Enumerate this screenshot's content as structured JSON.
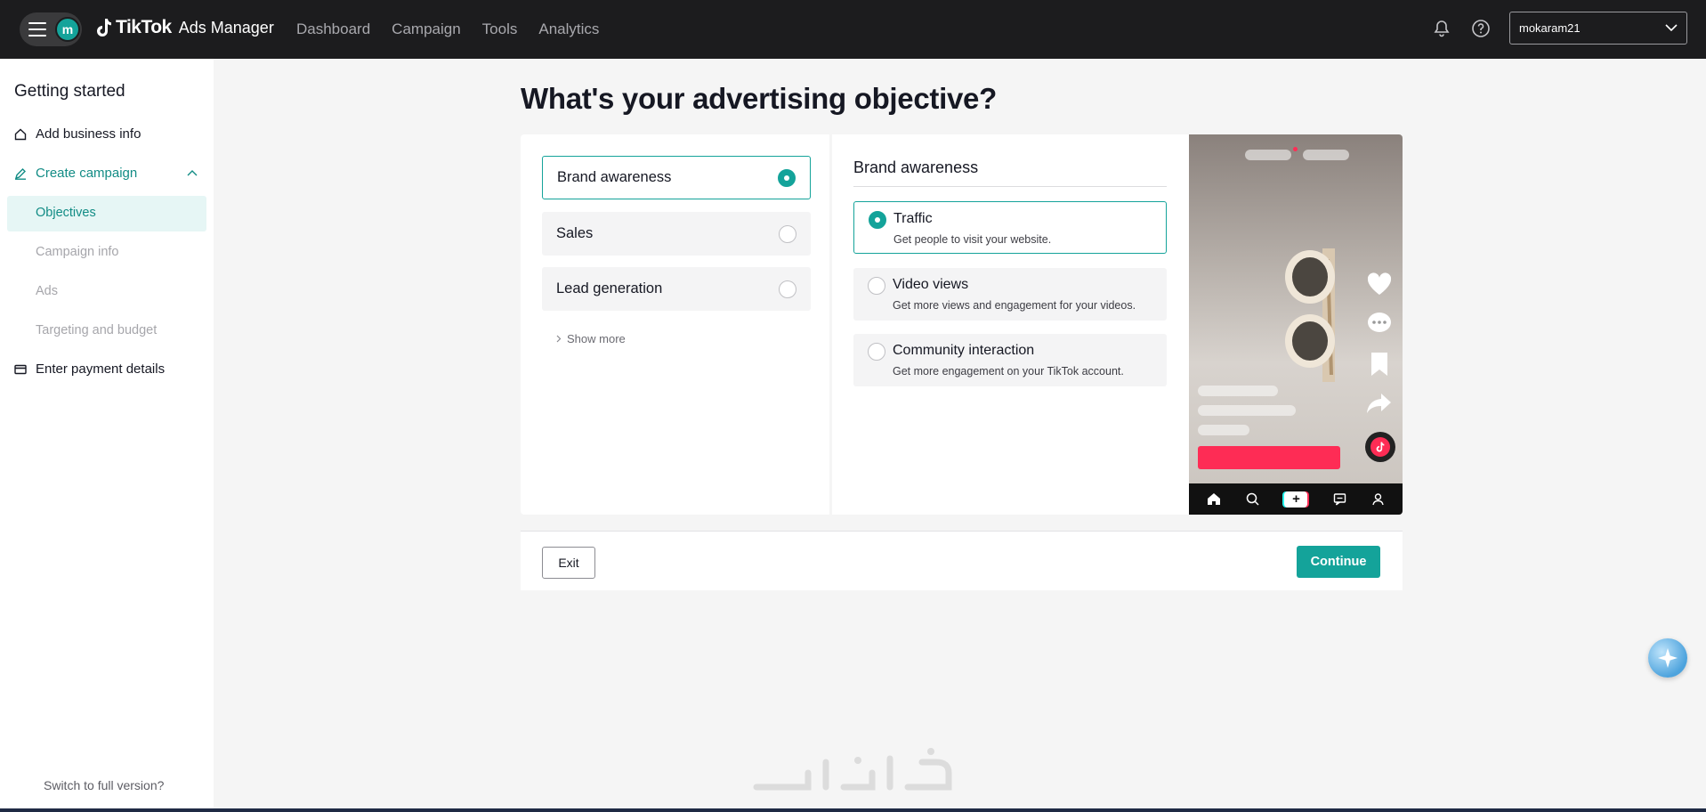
{
  "header": {
    "avatar_letter": "m",
    "logo_brand": "TikTok",
    "logo_product": "Ads Manager",
    "nav": [
      "Dashboard",
      "Campaign",
      "Tools",
      "Analytics"
    ],
    "account_name": "mokaram21"
  },
  "sidebar": {
    "title": "Getting started",
    "items": [
      {
        "label": "Add business info",
        "icon": "home-icon"
      },
      {
        "label": "Create campaign",
        "icon": "pencil-icon",
        "expanded": true
      },
      {
        "label": "Enter payment details",
        "icon": "card-icon"
      }
    ],
    "sub_items": [
      "Objectives",
      "Campaign info",
      "Ads",
      "Targeting and budget"
    ],
    "active_sub": "Objectives",
    "footer_link": "Switch to full version?"
  },
  "main": {
    "title": "What's your advertising objective?",
    "objectives": [
      {
        "label": "Brand awareness",
        "selected": true
      },
      {
        "label": "Sales",
        "selected": false
      },
      {
        "label": "Lead generation",
        "selected": false
      }
    ],
    "show_more": "Show more",
    "detail_title": "Brand awareness",
    "goals": [
      {
        "name": "Traffic",
        "desc": "Get people to visit your website.",
        "selected": true
      },
      {
        "name": "Video views",
        "desc": "Get more views and engagement for your videos.",
        "selected": false
      },
      {
        "name": "Community interaction",
        "desc": "Get more engagement on your TikTok account.",
        "selected": false
      }
    ]
  },
  "footer": {
    "exit_label": "Exit",
    "continue_label": "Continue"
  },
  "colors": {
    "accent": "#14a39a",
    "topbar": "#1c1c1e",
    "cta": "#fe2c55"
  }
}
